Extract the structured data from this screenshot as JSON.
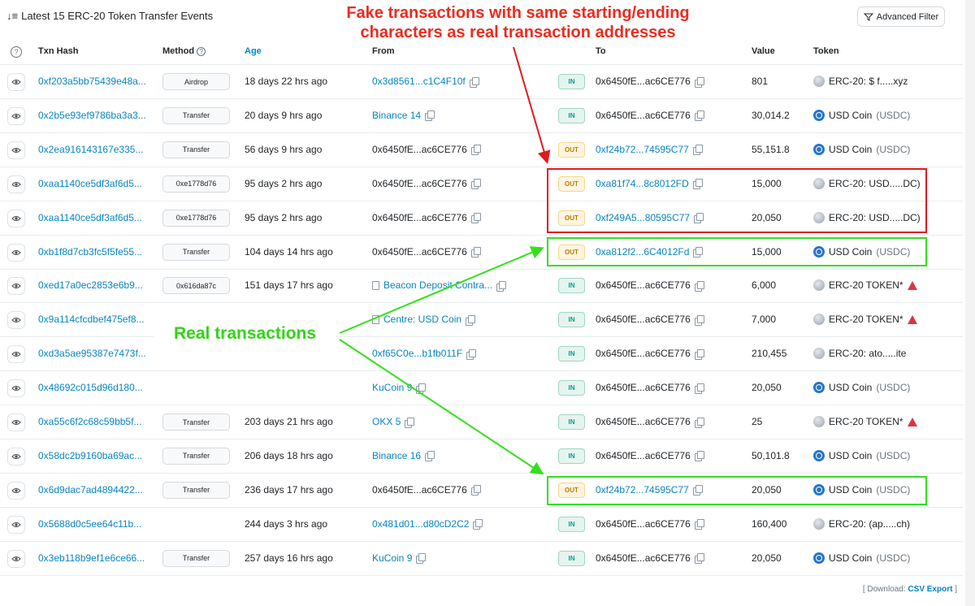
{
  "header": {
    "title": "Latest 15 ERC-20 Token Transfer Events",
    "advanced_filter": "Advanced Filter"
  },
  "columns": {
    "txn_hash": "Txn Hash",
    "method": "Method",
    "age": "Age",
    "from": "From",
    "to": "To",
    "value": "Value",
    "token": "Token"
  },
  "rows": [
    {
      "hash": "0xf203a5bb75439e48a...",
      "method": "Airdrop",
      "age": "18 days 22 hrs ago",
      "from": "0x3d8561...c1C4F10f",
      "from_link": true,
      "dir": "IN",
      "to": "0x6450fE...ac6CE776",
      "to_link": false,
      "value": "801",
      "token": "ERC-20: $ f.....xyz",
      "token_sym": "",
      "token_icon": "grey",
      "warn": false
    },
    {
      "hash": "0x2b5e93ef9786ba3a3...",
      "method": "Transfer",
      "age": "20 days 9 hrs ago",
      "from": "Binance 14",
      "from_link": true,
      "dir": "IN",
      "to": "0x6450fE...ac6CE776",
      "to_link": false,
      "value": "30,014.2",
      "token": "USD Coin",
      "token_sym": "(USDC)",
      "token_icon": "usdc",
      "warn": false
    },
    {
      "hash": "0x2ea916143167e335...",
      "method": "Transfer",
      "age": "56 days 9 hrs ago",
      "from": "0x6450fE...ac6CE776",
      "from_link": false,
      "dir": "OUT",
      "to": "0xf24b72...74595C77",
      "to_link": true,
      "value": "55,151.8",
      "token": "USD Coin",
      "token_sym": "(USDC)",
      "token_icon": "usdc",
      "warn": false
    },
    {
      "hash": "0xaa1140ce5df3af6d5...",
      "method": "0xe1778d76",
      "age": "95 days 2 hrs ago",
      "from": "0x6450fE...ac6CE776",
      "from_link": false,
      "dir": "OUT",
      "to": "0xa81f74...8c8012FD",
      "to_link": true,
      "value": "15,000",
      "token": "ERC-20: USD.....DC)",
      "token_sym": "",
      "token_icon": "grey",
      "warn": false
    },
    {
      "hash": "0xaa1140ce5df3af6d5...",
      "method": "0xe1778d76",
      "age": "95 days 2 hrs ago",
      "from": "0x6450fE...ac6CE776",
      "from_link": false,
      "dir": "OUT",
      "to": "0xf249A5...80595C77",
      "to_link": true,
      "value": "20,050",
      "token": "ERC-20: USD.....DC)",
      "token_sym": "",
      "token_icon": "grey",
      "warn": false
    },
    {
      "hash": "0xb1f8d7cb3fc5f5fe55...",
      "method": "Transfer",
      "age": "104 days 14 hrs ago",
      "from": "0x6450fE...ac6CE776",
      "from_link": false,
      "dir": "OUT",
      "to": "0xa812f2...6C4012Fd",
      "to_link": true,
      "value": "15,000",
      "token": "USD Coin",
      "token_sym": "(USDC)",
      "token_icon": "usdc",
      "warn": false
    },
    {
      "hash": "0xed17a0ec2853e6b9...",
      "method": "0x616da87c",
      "age": "151 days 17 hrs ago",
      "from": "Beacon Deposit Contra...",
      "from_link": true,
      "from_doc": true,
      "dir": "IN",
      "to": "0x6450fE...ac6CE776",
      "to_link": false,
      "value": "6,000",
      "token": "ERC-20 TOKEN*",
      "token_sym": "",
      "token_icon": "grey",
      "warn": true
    },
    {
      "hash": "0x9a114cfcdbef475ef8...",
      "method": "",
      "age": "",
      "from": "Centre: USD Coin",
      "from_link": true,
      "from_doc": true,
      "dir": "IN",
      "to": "0x6450fE...ac6CE776",
      "to_link": false,
      "value": "7,000",
      "token": "ERC-20 TOKEN*",
      "token_sym": "",
      "token_icon": "grey",
      "warn": true
    },
    {
      "hash": "0xd3a5ae95387e7473f...",
      "method": "",
      "age": "",
      "from": "0xf65C0e...b1fb011F",
      "from_link": true,
      "dir": "IN",
      "to": "0x6450fE...ac6CE776",
      "to_link": false,
      "value": "210,455",
      "token": "ERC-20: ato.....ite",
      "token_sym": "",
      "token_icon": "grey",
      "warn": false
    },
    {
      "hash": "0x48692c015d96d180...",
      "method": "",
      "age": "",
      "from": "KuCoin 9",
      "from_link": true,
      "dir": "IN",
      "to": "0x6450fE...ac6CE776",
      "to_link": false,
      "value": "20,050",
      "token": "USD Coin",
      "token_sym": "(USDC)",
      "token_icon": "usdc",
      "warn": false
    },
    {
      "hash": "0xa55c6f2c68c59bb5f...",
      "method": "Transfer",
      "age": "203 days 21 hrs ago",
      "from": "OKX 5",
      "from_link": true,
      "dir": "IN",
      "to": "0x6450fE...ac6CE776",
      "to_link": false,
      "value": "25",
      "token": "ERC-20 TOKEN*",
      "token_sym": "",
      "token_icon": "grey",
      "warn": true
    },
    {
      "hash": "0x58dc2b9160ba69ac...",
      "method": "Transfer",
      "age": "206 days 18 hrs ago",
      "from": "Binance 16",
      "from_link": true,
      "dir": "IN",
      "to": "0x6450fE...ac6CE776",
      "to_link": false,
      "value": "50,101.8",
      "token": "USD Coin",
      "token_sym": "(USDC)",
      "token_icon": "usdc",
      "warn": false
    },
    {
      "hash": "0x6d9dac7ad4894422...",
      "method": "Transfer",
      "age": "236 days 17 hrs ago",
      "from": "0x6450fE...ac6CE776",
      "from_link": false,
      "dir": "OUT",
      "to": "0xf24b72...74595C77",
      "to_link": true,
      "value": "20,050",
      "token": "USD Coin",
      "token_sym": "(USDC)",
      "token_icon": "usdc",
      "warn": false
    },
    {
      "hash": "0x5688d0c5ee64c11b...",
      "method": "",
      "age": "244 days 3 hrs ago",
      "from": "0x481d01...d80cD2C2",
      "from_link": true,
      "dir": "IN",
      "to": "0x6450fE...ac6CE776",
      "to_link": false,
      "value": "160,400",
      "token": "ERC-20: (ap.....ch)",
      "token_sym": "",
      "token_icon": "grey",
      "warn": false
    },
    {
      "hash": "0x3eb118b9ef1e6ce66...",
      "method": "Transfer",
      "age": "257 days 16 hrs ago",
      "from": "KuCoin 9",
      "from_link": true,
      "dir": "IN",
      "to": "0x6450fE...ac6CE776",
      "to_link": false,
      "value": "20,050",
      "token": "USD Coin",
      "token_sym": "(USDC)",
      "token_icon": "usdc",
      "warn": false
    }
  ],
  "annotations": {
    "fake_label": "Fake transactions with same starting/ending characters as real transaction addresses",
    "real_label": "Real transactions",
    "fake_color": "#ee2a1e",
    "real_color": "#32d416"
  },
  "footer": {
    "download_prefix": "[ Download:",
    "csv_export": "CSV Export",
    "suffix": "]"
  }
}
